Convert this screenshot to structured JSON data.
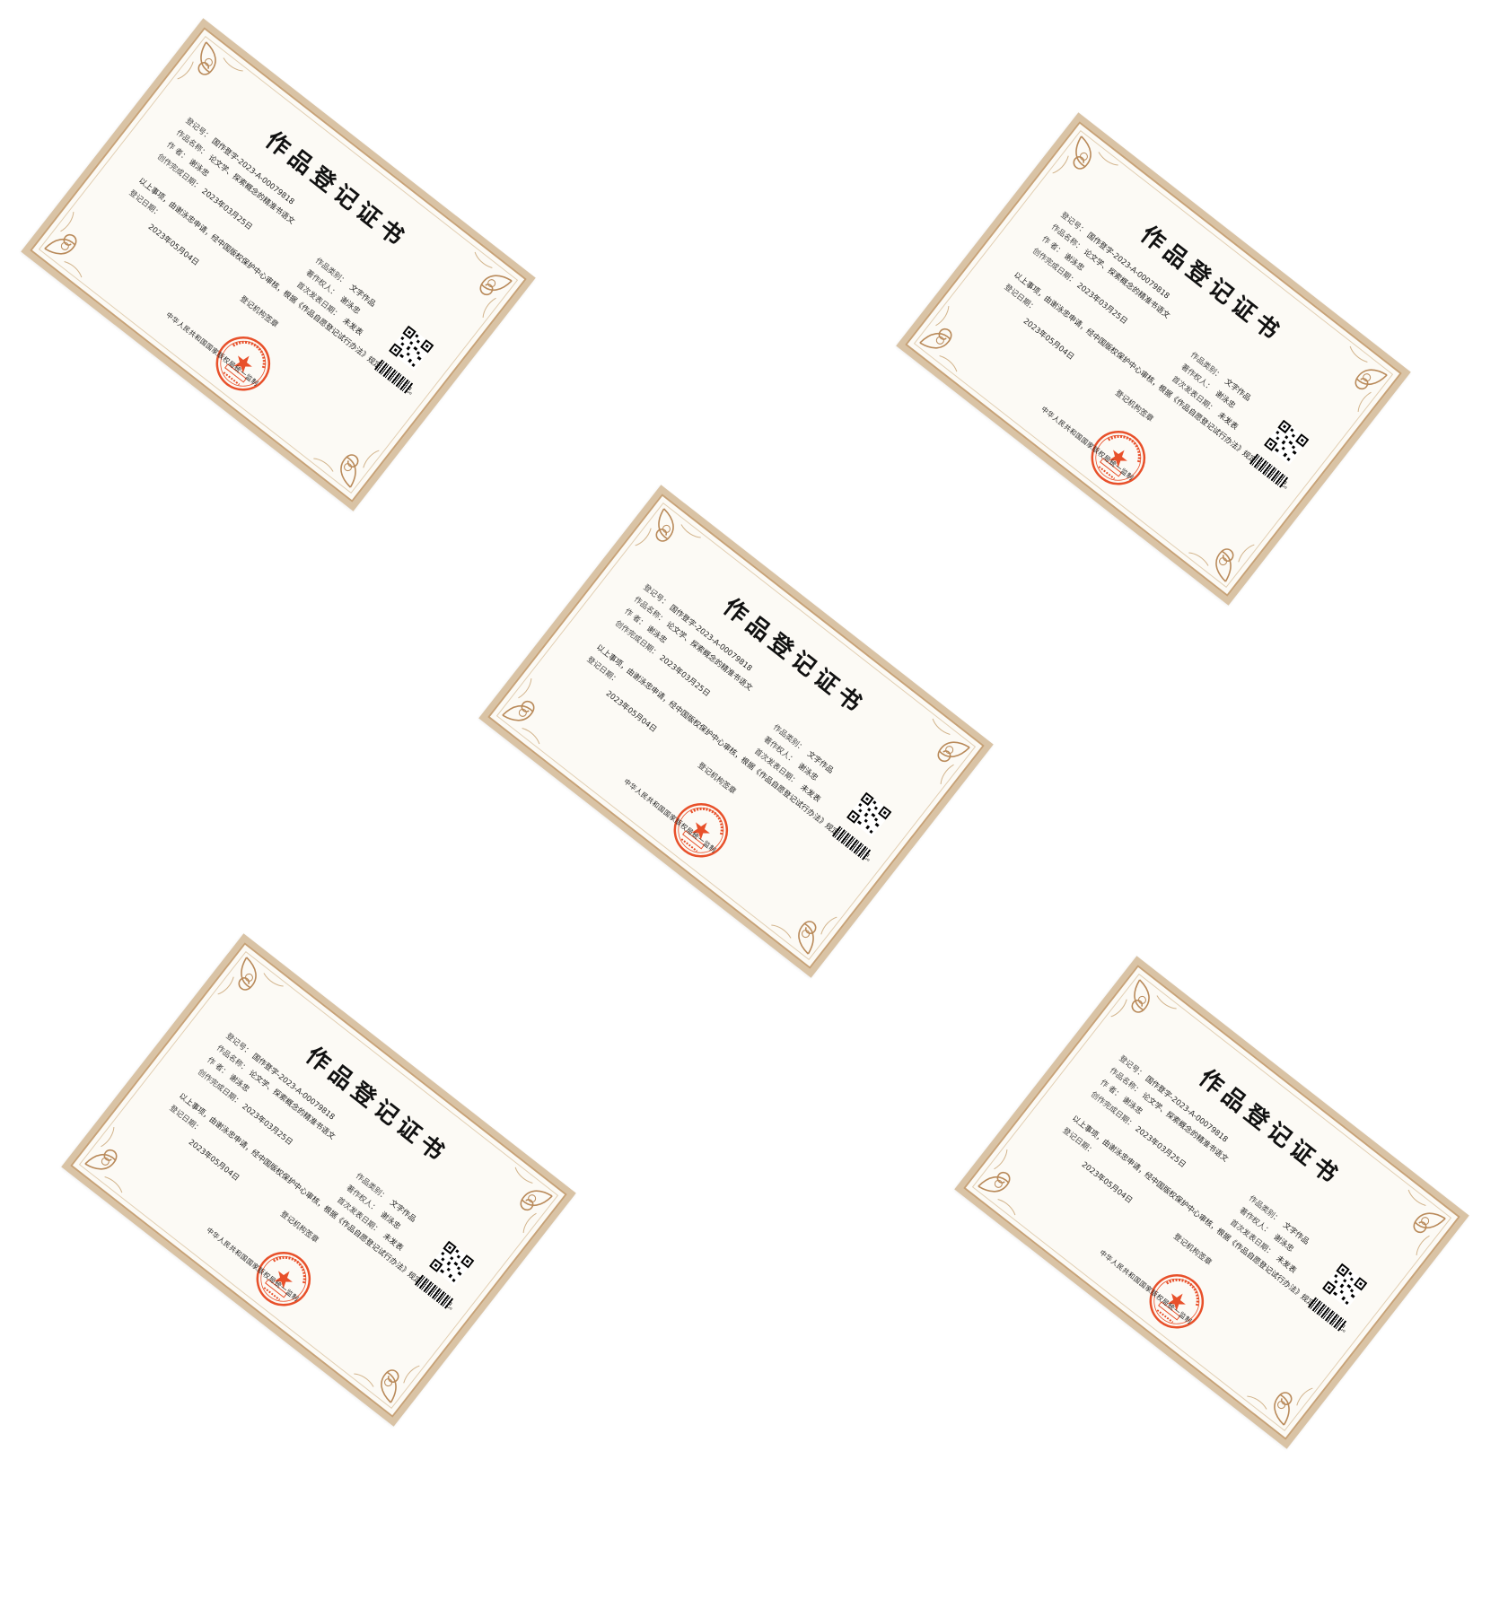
{
  "certificates": [
    {
      "title": "作品登记证书",
      "reg_no_label": "登记号：",
      "reg_no": "国作登字-2023-A-00079818",
      "work_name_label": "作品名称：",
      "work_name": "论文学、探索概念的精准书语文",
      "author_label": "作    者：",
      "author": "谢泳忠",
      "completion_date_label": "创作完成日期：",
      "completion_date": "2023年03月25日",
      "work_type_label": "作品类别：",
      "work_type": "文字作品",
      "copyright_owner_label": "著作权人：",
      "copyright_owner": "谢泳忠",
      "first_publish_label": "首次发表日期：",
      "first_publish": "未发表",
      "statement": "以上事项，由谢泳忠申请，经中国版权保护中心审核，根据《作品自愿登记试行办法》规定，予以登记。",
      "reg_date_label": "登记日期：",
      "reg_date": "2023年05月04日",
      "registrar": "登记机构签章",
      "issuer": "中华人民共和国国家版权局统一监制",
      "seal_text": "中华人民共和国国家版权局 作品登记 专用章"
    },
    {
      "title": "作品登记证书",
      "reg_no_label": "登记号：",
      "reg_no": "国作登字-2023-A-00079818",
      "work_name_label": "作品名称：",
      "work_name": "论文学、探索概念的精准书语文",
      "author_label": "作    者：",
      "author": "谢泳忠",
      "completion_date_label": "创作完成日期：",
      "completion_date": "2023年03月25日",
      "work_type_label": "作品类别：",
      "work_type": "文字作品",
      "copyright_owner_label": "著作权人：",
      "copyright_owner": "谢泳忠",
      "first_publish_label": "首次发表日期：",
      "first_publish": "未发表",
      "statement": "以上事项，由谢泳忠申请，经中国版权保护中心审核，根据《作品自愿登记试行办法》规定，予以登记。",
      "reg_date_label": "登记日期：",
      "reg_date": "2023年05月04日",
      "registrar": "登记机构签章",
      "issuer": "中华人民共和国国家版权局统一监制",
      "seal_text": "中华人民共和国国家版权局 作品登记 专用章"
    },
    {
      "title": "作品登记证书",
      "reg_no_label": "登记号：",
      "reg_no": "国作登字-2023-A-00079818",
      "work_name_label": "作品名称：",
      "work_name": "论文学、探索概念的精准书语文",
      "author_label": "作    者：",
      "author": "谢泳忠",
      "completion_date_label": "创作完成日期：",
      "completion_date": "2023年03月25日",
      "work_type_label": "作品类别：",
      "work_type": "文字作品",
      "copyright_owner_label": "著作权人：",
      "copyright_owner": "谢泳忠",
      "first_publish_label": "首次发表日期：",
      "first_publish": "未发表",
      "statement": "以上事项，由谢泳忠申请，经中国版权保护中心审核，根据《作品自愿登记试行办法》规定，予以登记。",
      "reg_date_label": "登记日期：",
      "reg_date": "2023年05月04日",
      "registrar": "登记机构签章",
      "issuer": "中华人民共和国国家版权局统一监制",
      "seal_text": "中华人民共和国国家版权局 作品登记 专用章"
    },
    {
      "title": "作品登记证书",
      "reg_no_label": "登记号：",
      "reg_no": "国作登字-2023-A-00079818",
      "work_name_label": "作品名称：",
      "work_name": "论文学、探索概念的精准书语文",
      "author_label": "作    者：",
      "author": "谢泳忠",
      "completion_date_label": "创作完成日期：",
      "completion_date": "2023年03月25日",
      "work_type_label": "作品类别：",
      "work_type": "文字作品",
      "copyright_owner_label": "著作权人：",
      "copyright_owner": "谢泳忠",
      "first_publish_label": "首次发表日期：",
      "first_publish": "未发表",
      "statement": "以上事项，由谢泳忠申请，经中国版权保护中心审核，根据《作品自愿登记试行办法》规定，予以登记。",
      "reg_date_label": "登记日期：",
      "reg_date": "2023年05月04日",
      "registrar": "登记机构签章",
      "issuer": "中华人民共和国国家版权局统一监制",
      "seal_text": "中华人民共和国国家版权局 作品登记 专用章"
    },
    {
      "title": "作品登记证书",
      "reg_no_label": "登记号：",
      "reg_no": "国作登字-2023-A-00079818",
      "work_name_label": "作品名称：",
      "work_name": "论文学、探索概念的精准书语文",
      "author_label": "作    者：",
      "author": "谢泳忠",
      "completion_date_label": "创作完成日期：",
      "completion_date": "2023年03月25日",
      "work_type_label": "作品类别：",
      "work_type": "文字作品",
      "copyright_owner_label": "著作权人：",
      "copyright_owner": "谢泳忠",
      "first_publish_label": "首次发表日期：",
      "first_publish": "未发表",
      "statement": "以上事项，由谢泳忠申请，经中国版权保护中心审核，根据《作品自愿登记试行办法》规定，予以登记。",
      "reg_date_label": "登记日期：",
      "reg_date": "2023年05月04日",
      "registrar": "登记机构签章",
      "issuer": "中华人民共和国国家版权局统一监制",
      "seal_text": "中华人民共和国国家版权局 作品登记 专用章"
    }
  ],
  "colors": {
    "frame": "#d9c3a5",
    "border": "#c7a277",
    "paper": "#fcfaf5",
    "seal": "#e8502a"
  }
}
